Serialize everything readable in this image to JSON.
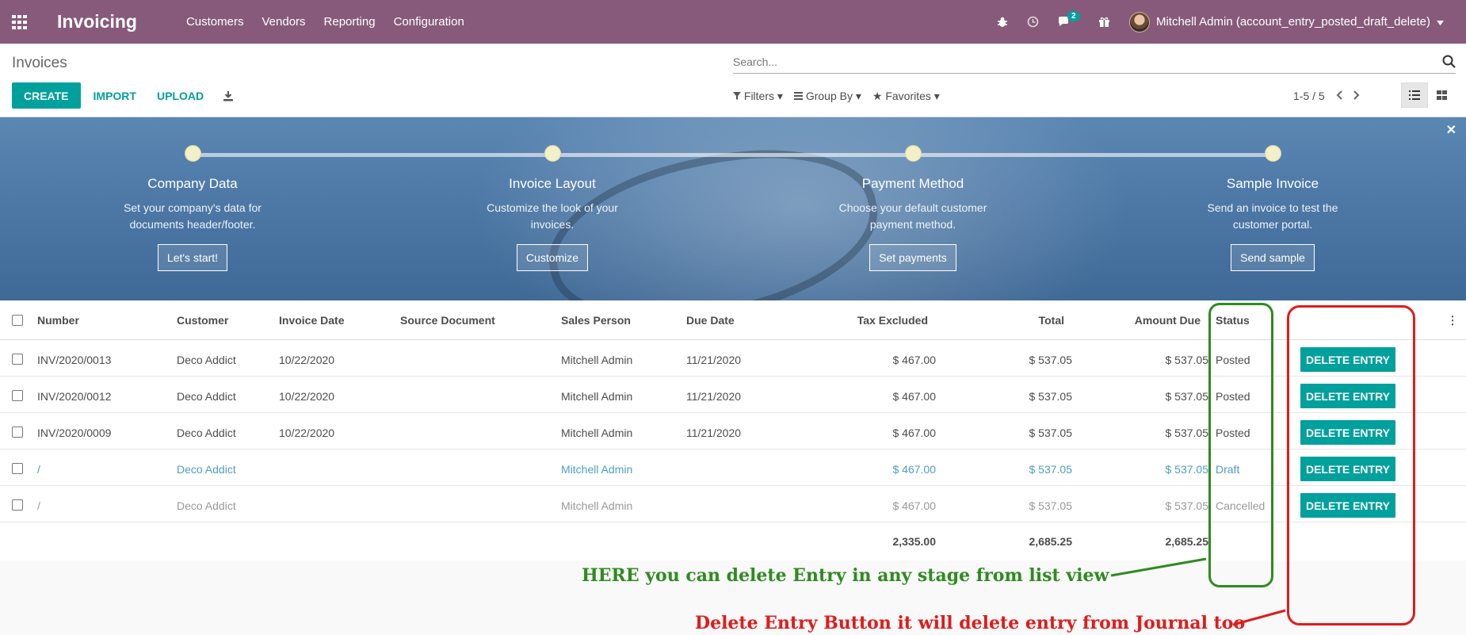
{
  "navbar": {
    "brand": "Invoicing",
    "menu": [
      "Customers",
      "Vendors",
      "Reporting",
      "Configuration"
    ],
    "messages_count": "2",
    "user": "Mitchell Admin (account_entry_posted_draft_delete)"
  },
  "control_panel": {
    "breadcrumb": "Invoices",
    "search_placeholder": "Search...",
    "create_label": "CREATE",
    "import_label": "IMPORT",
    "upload_label": "UPLOAD",
    "filters_label": "Filters",
    "groupby_label": "Group By",
    "favorites_label": "Favorites",
    "pager": "1-5 / 5"
  },
  "banner": {
    "steps": [
      {
        "title": "Company Data",
        "desc": "Set your company's data for documents header/footer.",
        "button": "Let's start!"
      },
      {
        "title": "Invoice Layout",
        "desc": "Customize the look of your invoices.",
        "button": "Customize"
      },
      {
        "title": "Payment Method",
        "desc": "Choose your default customer payment method.",
        "button": "Set payments"
      },
      {
        "title": "Sample Invoice",
        "desc": "Send an invoice to test the customer portal.",
        "button": "Send sample"
      }
    ]
  },
  "table": {
    "columns": [
      "Number",
      "Customer",
      "Invoice Date",
      "Source Document",
      "Sales Person",
      "Due Date",
      "Tax Excluded",
      "Total",
      "Amount Due",
      "Status"
    ],
    "rows": [
      {
        "number": "INV/2020/0013",
        "customer": "Deco Addict",
        "invoice_date": "10/22/2020",
        "source": "",
        "salesperson": "Mitchell Admin",
        "due_date": "11/21/2020",
        "tax_excluded": "$ 467.00",
        "total": "$ 537.05",
        "amount_due": "$ 537.05",
        "status": "Posted",
        "action": "DELETE ENTRY"
      },
      {
        "number": "INV/2020/0012",
        "customer": "Deco Addict",
        "invoice_date": "10/22/2020",
        "source": "",
        "salesperson": "Mitchell Admin",
        "due_date": "11/21/2020",
        "tax_excluded": "$ 467.00",
        "total": "$ 537.05",
        "amount_due": "$ 537.05",
        "status": "Posted",
        "action": "DELETE ENTRY"
      },
      {
        "number": "INV/2020/0009",
        "customer": "Deco Addict",
        "invoice_date": "10/22/2020",
        "source": "",
        "salesperson": "Mitchell Admin",
        "due_date": "11/21/2020",
        "tax_excluded": "$ 467.00",
        "total": "$ 537.05",
        "amount_due": "$ 537.05",
        "status": "Posted",
        "action": "DELETE ENTRY"
      },
      {
        "number": "/",
        "customer": "Deco Addict",
        "invoice_date": "",
        "source": "",
        "salesperson": "Mitchell Admin",
        "due_date": "",
        "tax_excluded": "$ 467.00",
        "total": "$ 537.05",
        "amount_due": "$ 537.05",
        "status": "Draft",
        "action": "DELETE ENTRY"
      },
      {
        "number": "/",
        "customer": "Deco Addict",
        "invoice_date": "",
        "source": "",
        "salesperson": "Mitchell Admin",
        "due_date": "",
        "tax_excluded": "$ 467.00",
        "total": "$ 537.05",
        "amount_due": "$ 537.05",
        "status": "Cancelled",
        "action": "DELETE ENTRY"
      }
    ],
    "totals": {
      "tax_excluded": "2,335.00",
      "total": "2,685.25",
      "amount_due": "2,685.25"
    }
  },
  "annotations": {
    "green": "HERE you can delete Entry in any stage from list view",
    "red": "Delete Entry Button it will delete entry from Journal too",
    "green_color": "#2e8b1f",
    "red_color": "#e11b1b"
  },
  "colors": {
    "navbar": "#875a7b",
    "primary": "#00a09d",
    "draft_text": "#4e9ec2"
  }
}
